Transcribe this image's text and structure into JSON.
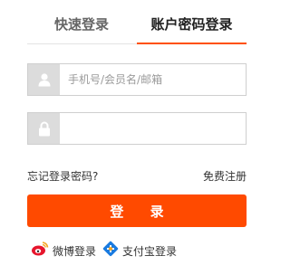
{
  "tabs": {
    "quick_login": "快速登录",
    "account_login": "账户密码登录"
  },
  "form": {
    "username_placeholder": "手机号/会员名/邮箱",
    "username_value": "",
    "password_placeholder": "",
    "password_value": ""
  },
  "links": {
    "forgot_password": "忘记登录密码?",
    "register": "免费注册"
  },
  "login_button": "登 录",
  "third_party": {
    "weibo": "微博登录",
    "alipay": "支付宝登录"
  },
  "colors": {
    "accent": "#ff4a00",
    "icon_box": "#dcdcdc"
  },
  "icons": {
    "username": "user-icon",
    "password": "lock-icon",
    "weibo": "weibo-icon",
    "alipay": "alipay-icon"
  }
}
